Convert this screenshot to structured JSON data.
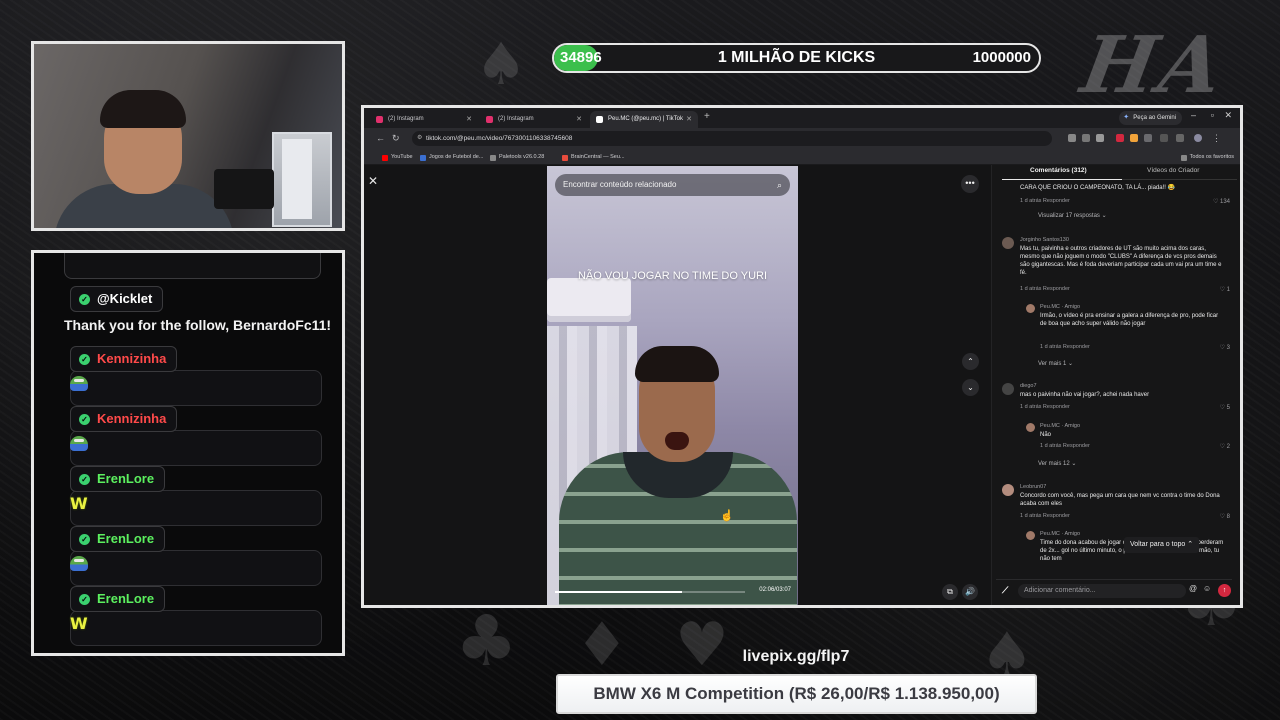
{
  "overlay": {
    "kicks_bar": {
      "current": "34896",
      "title": "1 MILHÃO DE KICKS",
      "goal": "1000000",
      "progress_fraction": 0.0349
    },
    "haha_text": "HA HA",
    "livepix_url": "livepix.gg/flp7",
    "goal_banner": "BMW X6 M Competition (R$ 26,00/R$ 1.138.950,00)"
  },
  "chat": {
    "messages": [
      {
        "user": "@Kicklet",
        "user_color": "#ffffff",
        "text": "Thank you for the follow, BernardoFc11!",
        "emote": ""
      },
      {
        "user": "Kennizinha",
        "user_color": "#ff4a4a",
        "text": "",
        "emote": "pepe"
      },
      {
        "user": "Kennizinha",
        "user_color": "#ff4a4a",
        "text": "",
        "emote": "pepe"
      },
      {
        "user": "ErenLore",
        "user_color": "#5cf05f",
        "text": "",
        "emote": "W"
      },
      {
        "user": "ErenLore",
        "user_color": "#5cf05f",
        "text": "",
        "emote": "pepe"
      },
      {
        "user": "ErenLore",
        "user_color": "#5cf05f",
        "text": "",
        "emote": "W"
      }
    ]
  },
  "browser": {
    "tabs": [
      {
        "label": "(2) Instagram",
        "icon_color": "#e1306c",
        "active": false
      },
      {
        "label": "(2) Instagram",
        "icon_color": "#e1306c",
        "active": false
      },
      {
        "label": "Peu.MC (@peu.mc) | TikTok",
        "icon_color": "#ffffff",
        "active": true
      }
    ],
    "gemini_label": "Peça ao Gemini",
    "url": "tiktok.com/@peu.mc/video/7673001106338745608",
    "bookmarks": [
      {
        "label": "YouTube",
        "icon_color": "#ff0000"
      },
      {
        "label": "Jogos de Futebol de...",
        "icon_color": "#3b6fd1"
      },
      {
        "label": "Paletools v26.0.28",
        "icon_color": "#888888"
      },
      {
        "label": "BrainCentral — Seu...",
        "icon_color": "#e84c3d"
      }
    ],
    "bookmarks_right": "Todos os favoritos"
  },
  "tiktok": {
    "search_placeholder": "Encontrar conteúdo relacionado",
    "caption": "NÃO VOU JOGAR NO TIME DO YURI",
    "time": "02:06/03:07",
    "progress_fraction": 0.67,
    "comments_tab": "Comentários (312)",
    "creator_tab": "Vídeos do Criador",
    "comments": [
      {
        "text": "CARA QUE CRIOU O CAMPEONATO, TA LÁ... piada!! 😂",
        "meta": "1 d atrás   Responder",
        "likes": "♡ 134",
        "more": "Visualizar 17 respostas ⌄"
      },
      {
        "user": "Jorginho Santos130",
        "text": "Mas tu, paivinha e outros criadores de UT são muito acima dos caras, mesmo que não joguem o modo \"CLUBS\" A diferença de vcs pros demais são gigantescas. Mas é foda deveriam participar cada um vai pra um time e fé.",
        "meta": "1 d atrás   Responder",
        "likes": "♡ 1"
      },
      {
        "user": "Peu.MC · Amigo",
        "text": "Irmão, o vídeo é pra ensinar a galera a diferença de pro, pode ficar de boa que acho super válido não jogar",
        "meta": "1 d atrás   Responder",
        "likes": "♡ 3",
        "more": "Ver mais 1 ⌄"
      },
      {
        "user": "diego7",
        "text": "mas o paivinha não vai jogar?, achei nada haver",
        "meta": "1 d atrás   Responder",
        "likes": "♡ 5"
      },
      {
        "user": "Peu.MC · Amigo",
        "text": "Não",
        "meta": "1 d atrás   Responder",
        "likes": "♡ 2",
        "more": "Ver mais 12 ⌄"
      },
      {
        "user": "Leobrun07",
        "text": "Concordo com você, mas pega um cara que nem vc contra o time do Dona acaba com eles",
        "meta": "1 d atrás   Responder",
        "likes": "♡ 8"
      },
      {
        "user": "Peu.MC · Amigo",
        "text": "Time do dona acabou de jogar contra PHZIN, Young, Mh e perderam de 2x... gol no último minuto, o pro clubs é muito diferente irmão, tu não tem"
      }
    ],
    "back_to_top": "Voltar para o topo ⌃",
    "comment_placeholder": "Adicionar comentário..."
  }
}
